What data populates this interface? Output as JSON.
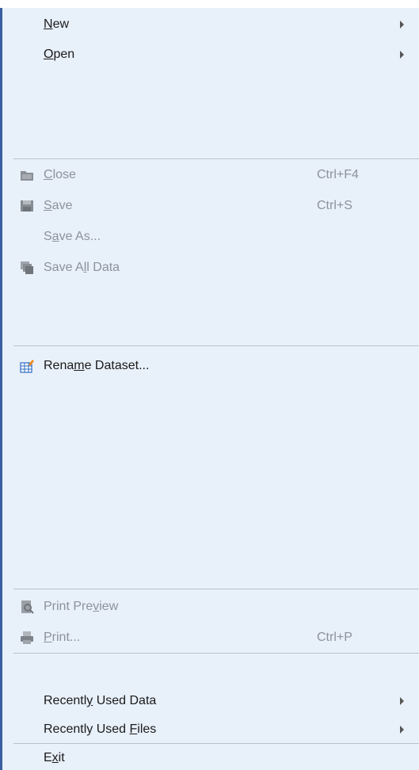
{
  "menu": {
    "new": {
      "pre": "",
      "ul": "N",
      "post": "ew"
    },
    "open": {
      "pre": "",
      "ul": "O",
      "post": "pen"
    },
    "close": {
      "pre": "",
      "ul": "C",
      "post": "lose",
      "shortcut": "Ctrl+F4"
    },
    "save": {
      "pre": "",
      "ul": "S",
      "post": "ave",
      "shortcut": "Ctrl+S"
    },
    "save_as": {
      "pre": "S",
      "ul": "a",
      "post": "ve As..."
    },
    "save_all": {
      "pre": "Save A",
      "ul": "l",
      "post": "l Data"
    },
    "rename": {
      "pre": "Rena",
      "ul": "m",
      "post": "e Dataset..."
    },
    "print_preview": {
      "pre": "Print Pre",
      "ul": "v",
      "post": "iew"
    },
    "print": {
      "pre": "",
      "ul": "P",
      "post": "rint...",
      "shortcut": "Ctrl+P"
    },
    "recent_data": {
      "pre": "Recentl",
      "ul": "y",
      "post": " Used Data"
    },
    "recent_files": {
      "pre": "Recently Used ",
      "ul": "F",
      "post": "iles"
    },
    "exit": {
      "pre": "E",
      "ul": "x",
      "post": "it"
    }
  },
  "icons": {
    "close": "folder-close-icon",
    "save": "floppy-disk-icon",
    "save_all": "multiple-disks-icon",
    "rename": "table-edit-icon",
    "print_preview": "print-preview-icon",
    "print": "printer-icon"
  },
  "colors": {
    "menu_bg": "#e8f0fa",
    "left_border": "#3a5fa0",
    "disabled_text": "#8d929a",
    "separator": "#b8c3cf"
  }
}
